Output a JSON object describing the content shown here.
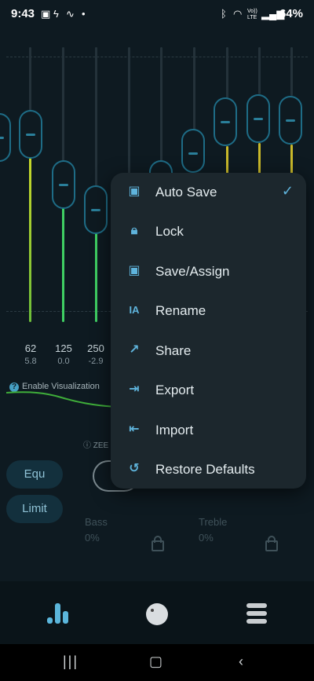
{
  "status": {
    "time": "9:43",
    "battery": "64%",
    "left_icons": [
      "image-icon",
      "bolt-icon",
      "waveform-icon",
      "dot-icon"
    ],
    "right_icons": [
      "bluetooth-icon",
      "wifi-icon",
      "volte-icon",
      "signal-icon"
    ],
    "volte_text": "Vo)) LTE"
  },
  "eq": {
    "bands": [
      {
        "freq": "62",
        "gain": "5.8"
      },
      {
        "freq": "125",
        "gain": "0.0"
      },
      {
        "freq": "250",
        "gain": "-2.9"
      }
    ],
    "visualization_label": "Enable Visualization",
    "zee_label": "ZEE"
  },
  "modes": {
    "equ": "Equ",
    "limit": "Limit"
  },
  "knobs": {
    "bass_label": "Bass",
    "bass_value": "0%",
    "treble_label": "Treble",
    "treble_value": "0%"
  },
  "menu": {
    "items": [
      {
        "label": "Auto Save",
        "icon": "save-icon",
        "checked": true
      },
      {
        "label": "Lock",
        "icon": "lock-icon"
      },
      {
        "label": "Save/Assign",
        "icon": "save-assign-icon"
      },
      {
        "label": "Rename",
        "icon": "rename-icon"
      },
      {
        "label": "Share",
        "icon": "share-icon"
      },
      {
        "label": "Export",
        "icon": "export-icon"
      },
      {
        "label": "Import",
        "icon": "import-icon"
      },
      {
        "label": "Restore Defaults",
        "icon": "restore-icon"
      }
    ]
  },
  "nav": {
    "items": [
      "equalizer-nav-icon",
      "knob-nav-icon",
      "menu-nav-icon"
    ]
  },
  "colors": {
    "accent": "#5fb4dc",
    "background": "#0e1a21",
    "menu_bg": "#1c272d",
    "green_fill": "#3fcf63",
    "yellow_fill": "#c9d82a"
  }
}
